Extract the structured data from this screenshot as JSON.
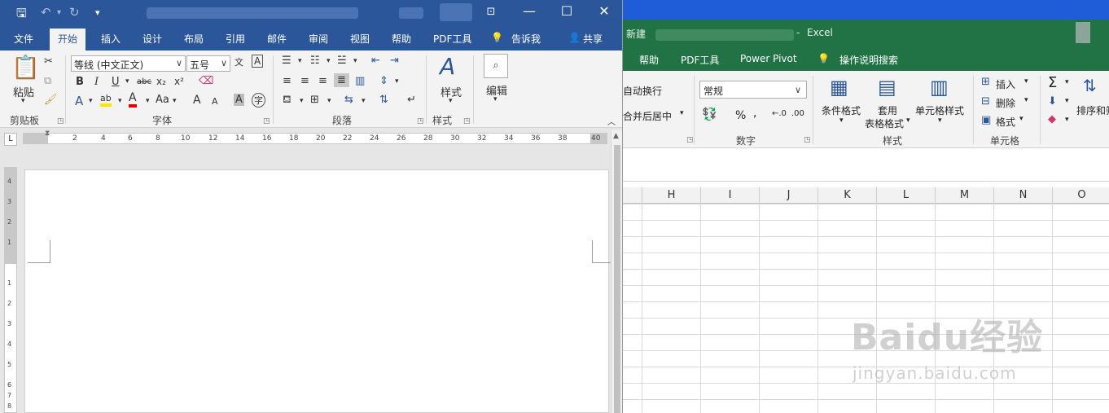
{
  "excel": {
    "app_name": "Excel",
    "doc_name": "新建",
    "title_sep": "-",
    "tabs": [
      "帮助",
      "PDF工具",
      "Power Pivot"
    ],
    "tell_me": "操作说明搜索",
    "wrap_text": "自动换行",
    "merge_center": "合并后居中",
    "number_format": "常规",
    "percent": "%",
    "comma": ",",
    "conditional_format": "条件格式",
    "format_as_table_1": "套用",
    "format_as_table_2": "表格格式",
    "cell_styles": "单元格样式",
    "insert": "插入",
    "delete": "删除",
    "format": "格式",
    "sort_filter": "排序和筛",
    "groups": {
      "number": "数字",
      "styles": "样式",
      "cells": "单元格"
    },
    "columns": [
      "H",
      "I",
      "J",
      "K",
      "L",
      "M",
      "N",
      "O"
    ],
    "watermark_1": "Baidu经验",
    "watermark_2": "jingyan.baidu.com"
  },
  "word": {
    "tabs": [
      "文件",
      "开始",
      "插入",
      "设计",
      "布局",
      "引用",
      "邮件",
      "审阅",
      "视图",
      "帮助",
      "PDF工具",
      "告诉我",
      "共享"
    ],
    "active_tab": "开始",
    "font_name": "等线 (中文正文)",
    "font_size": "五号",
    "paste": "粘贴",
    "styles": "样式",
    "edit": "编辑",
    "groups": {
      "clipboard": "剪贴板",
      "font": "字体",
      "paragraph": "段落",
      "styles": "样式"
    },
    "format_buttons": {
      "bold": "B",
      "italic": "I",
      "underline": "U",
      "strike": "abc",
      "sub": "x₂",
      "sup": "x²"
    },
    "font_more": {
      "text_effect": "A",
      "highlight": "ab",
      "font_color": "A",
      "change_case": "Aa",
      "grow": "A",
      "shrink": "A",
      "shade": "A",
      "enclose": "字"
    },
    "phonetic": "文",
    "border_char": "A",
    "ruler_numbers": [
      "2",
      "4",
      "6",
      "8",
      "10",
      "12",
      "14",
      "16",
      "18",
      "20",
      "22",
      "24",
      "26",
      "28",
      "30",
      "32",
      "34",
      "36",
      "38",
      "40"
    ],
    "vruler_numbers": [
      "4",
      "3",
      "2",
      "1",
      "1",
      "2",
      "3",
      "4",
      "5",
      "6",
      "7",
      "8"
    ],
    "tab_selector": "L"
  },
  "colors": {
    "word_blue": "#2b579a",
    "excel_green": "#217346"
  }
}
